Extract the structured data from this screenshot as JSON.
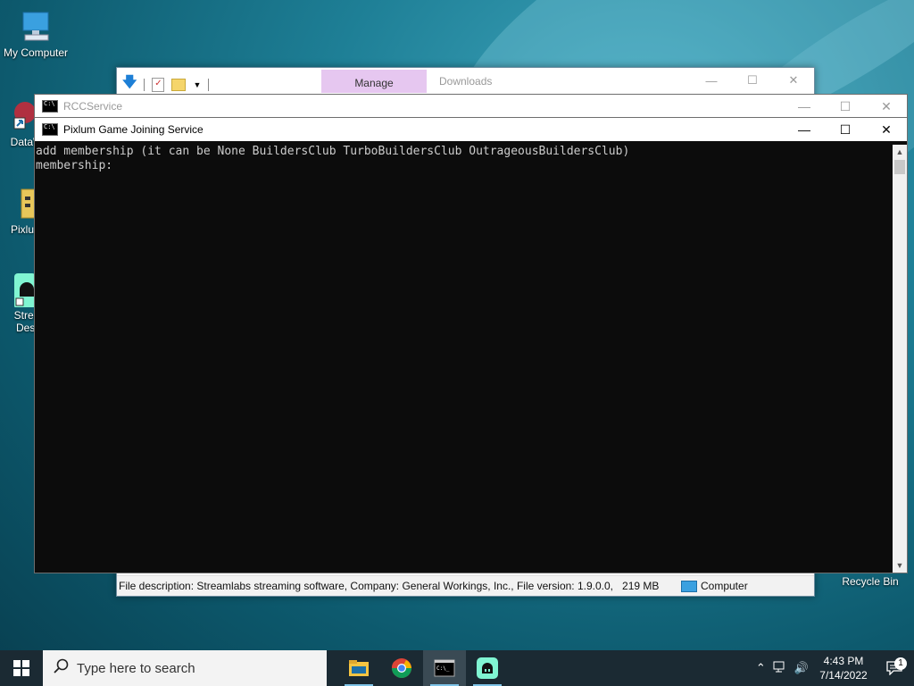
{
  "desktop": {
    "icons": [
      {
        "label": "My Computer"
      },
      {
        "label": "DataW"
      },
      {
        "label": "Pixlum"
      },
      {
        "label": "Strea"
      },
      {
        "label": "Desl"
      },
      {
        "label": "Recycle Bin"
      }
    ]
  },
  "explorer": {
    "manage_tab": "Manage",
    "title": "Downloads",
    "status": {
      "file_description": "File description: Streamlabs streaming software, Company: General Workings, Inc., File version: 1.9.0.0,",
      "size": "219 MB",
      "location": "Computer"
    }
  },
  "rcc_window": {
    "title": "RCCService"
  },
  "console_window": {
    "title": "Pixlum Game Joining Service",
    "lines": [
      "add membership (it can be None BuildersClub TurboBuildersClub OutrageousBuildersClub)",
      "membership:"
    ]
  },
  "taskbar": {
    "search_placeholder": "Type here to search",
    "apps": [
      "file-explorer",
      "chrome",
      "console",
      "streamlabs"
    ],
    "clock": {
      "time": "4:43 PM",
      "date": "7/14/2022"
    },
    "notification_count": "1"
  },
  "colors": {
    "manage_tab": "#e6c7f0",
    "console_bg": "#0c0c0c",
    "console_text": "#cccccc",
    "taskbar": "#1b2a33"
  }
}
